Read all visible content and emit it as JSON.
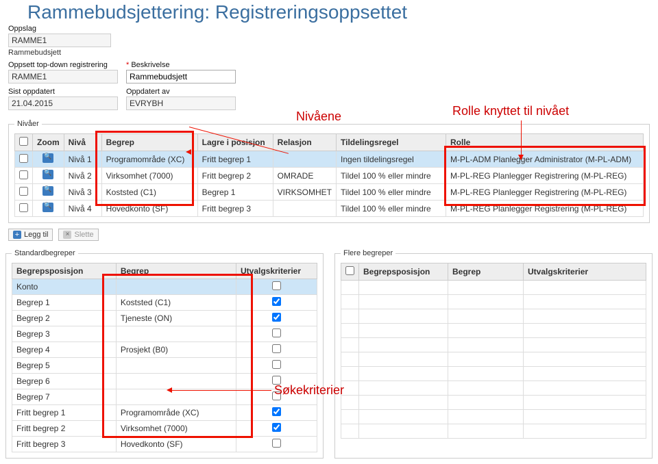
{
  "title": "Rammebudsjettering: Registreringsoppsettet",
  "annotations": {
    "nivaene": "Nivåene",
    "rolle": "Rolle knyttet til nivået",
    "sokekriterier": "Søkekriterier"
  },
  "lookup": {
    "label": "Oppslag",
    "value": "RAMME1",
    "subtitle": "Rammebudsjett"
  },
  "setup": {
    "codeLabel": "Oppsett top-down registrering",
    "codeValue": "RAMME1",
    "descLabel": "Beskrivelse",
    "descValue": "Rammebudsjett",
    "updatedLabel": "Sist oppdatert",
    "updatedValue": "21.04.2015",
    "byLabel": "Oppdatert av",
    "byValue": "EVRYBH"
  },
  "levelsLegend": "Nivåer",
  "levelsHeaders": {
    "chk": "",
    "zoom": "Zoom",
    "niva": "Nivå",
    "begrep": "Begrep",
    "lagre": "Lagre i posisjon",
    "relasjon": "Relasjon",
    "tildeling": "Tildelingsregel",
    "rolle": "Rolle"
  },
  "levels": [
    {
      "niva": "Nivå 1",
      "begrep": "Programområde (XC)",
      "lagre": "Fritt begrep 1",
      "relasjon": "",
      "tildeling": "Ingen tildelingsregel",
      "rolle": "M-PL-ADM Planlegger Administrator (M-PL-ADM)",
      "selected": true
    },
    {
      "niva": "Nivå 2",
      "begrep": "Virksomhet (7000)",
      "lagre": "Fritt begrep 2",
      "relasjon": "OMRADE",
      "tildeling": "Tildel 100 % eller mindre",
      "rolle": "M-PL-REG Planlegger Registrering (M-PL-REG)"
    },
    {
      "niva": "Nivå 3",
      "begrep": "Koststed (C1)",
      "lagre": "Begrep 1",
      "relasjon": "VIRKSOMHET",
      "tildeling": "Tildel 100 % eller mindre",
      "rolle": "M-PL-REG Planlegger Registrering (M-PL-REG)"
    },
    {
      "niva": "Nivå 4",
      "begrep": "Hovedkonto (SF)",
      "lagre": "Fritt begrep 3",
      "relasjon": "",
      "tildeling": "Tildel 100 % eller mindre",
      "rolle": "M-PL-REG Planlegger Registrering (M-PL-REG)"
    }
  ],
  "actions": {
    "add": "Legg til",
    "delete": "Slette"
  },
  "standardLegend": "Standardbegreper",
  "flereLegend": "Flere begreper",
  "stdHeaders": {
    "pos": "Begrepsposisjon",
    "begrep": "Begrep",
    "utvalg": "Utvalgskriterier"
  },
  "standard": [
    {
      "pos": "Konto",
      "begrep": "",
      "chk": false,
      "selected": true
    },
    {
      "pos": "Begrep 1",
      "begrep": "Koststed (C1)",
      "chk": true
    },
    {
      "pos": "Begrep 2",
      "begrep": "Tjeneste (ON)",
      "chk": true
    },
    {
      "pos": "Begrep 3",
      "begrep": "",
      "chk": false
    },
    {
      "pos": "Begrep 4",
      "begrep": "Prosjekt (B0)",
      "chk": false
    },
    {
      "pos": "Begrep 5",
      "begrep": "",
      "chk": false
    },
    {
      "pos": "Begrep 6",
      "begrep": "",
      "chk": false
    },
    {
      "pos": "Begrep 7",
      "begrep": "",
      "chk": false
    },
    {
      "pos": "Fritt begrep 1",
      "begrep": "Programområde (XC)",
      "chk": true
    },
    {
      "pos": "Fritt begrep 2",
      "begrep": "Virksomhet (7000)",
      "chk": true
    },
    {
      "pos": "Fritt begrep 3",
      "begrep": "Hovedkonto (SF)",
      "chk": false
    }
  ],
  "flereEmptyRows": 11
}
